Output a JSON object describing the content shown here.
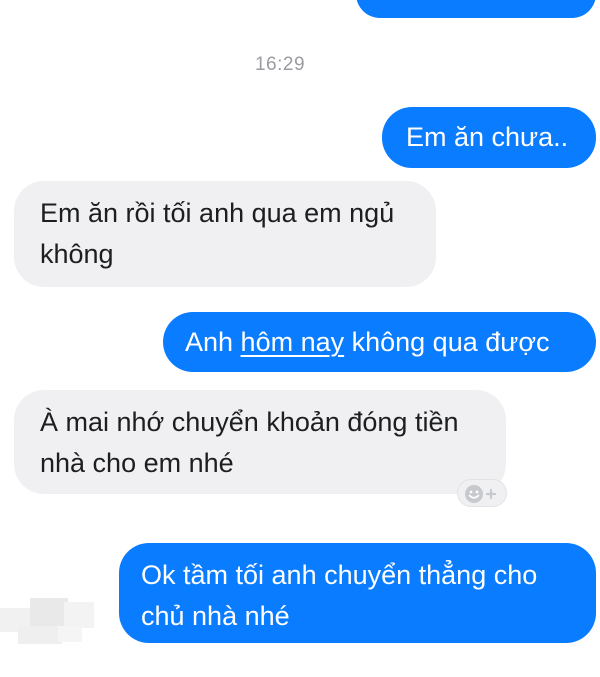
{
  "conversation": {
    "timestamp": "16:29",
    "messages": [
      {
        "direction": "outgoing",
        "text": "Em ăn chưa.."
      },
      {
        "direction": "incoming",
        "lines": [
          "Em ăn rồi tối anh qua em ngủ",
          "không"
        ]
      },
      {
        "direction": "outgoing",
        "parts": [
          "Anh ",
          "hôm nay",
          " không qua được"
        ]
      },
      {
        "direction": "incoming",
        "lines": [
          "À mai nhớ chuyển khoản đóng tiền",
          "nhà cho em nhé"
        ]
      },
      {
        "direction": "outgoing",
        "lines": [
          "Ok tầm tối anh chuyển thẳng cho",
          "chủ nhà nhé"
        ]
      }
    ]
  },
  "icons": {
    "react": "add-reaction-icon"
  },
  "colors": {
    "outgoing_bubble": "#0a7cff",
    "incoming_bubble": "#f0f0f2",
    "timestamp": "#9a9ca1"
  }
}
